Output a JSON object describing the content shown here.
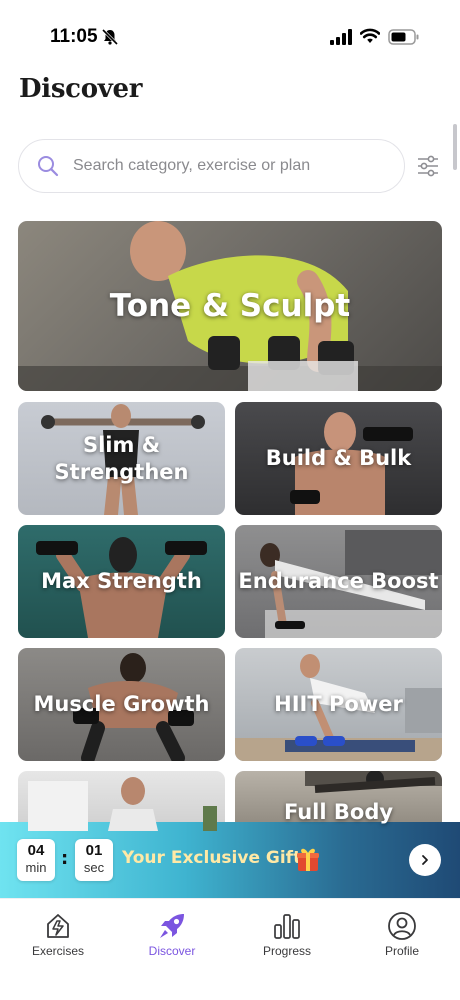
{
  "status_bar": {
    "time": "11:05"
  },
  "header": {
    "title": "Discover"
  },
  "search": {
    "placeholder": "Search category, exercise or plan"
  },
  "categories": [
    {
      "label": "Tone & Sculpt"
    },
    {
      "label": "Slim & Strengthen"
    },
    {
      "label": "Build & Bulk"
    },
    {
      "label": "Max Strength"
    },
    {
      "label": "Endurance Boost"
    },
    {
      "label": "Muscle Growth"
    },
    {
      "label": "HIIT Power"
    },
    {
      "label": ""
    },
    {
      "label": "Full Body"
    }
  ],
  "gift_banner": {
    "minutes": "04",
    "minutes_unit": "min",
    "seconds": "01",
    "seconds_unit": "sec",
    "colon": ":",
    "text": "Your Exclusive Gift"
  },
  "nav": {
    "items": [
      {
        "label": "Exercises",
        "icon": "dumbbell-house-icon"
      },
      {
        "label": "Discover",
        "icon": "rocket-icon",
        "active": true
      },
      {
        "label": "Progress",
        "icon": "bar-chart-icon"
      },
      {
        "label": "Profile",
        "icon": "person-icon"
      }
    ]
  },
  "colors": {
    "accent": "#7b55e0",
    "gift_text": "#ffe9a6"
  }
}
